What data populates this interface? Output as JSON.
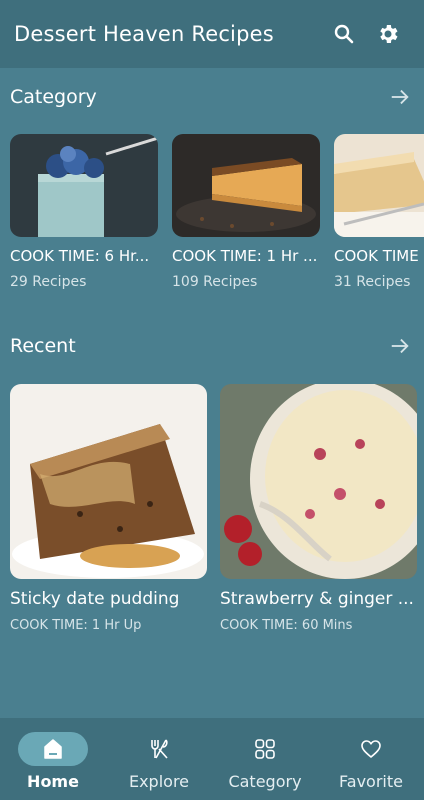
{
  "appbar": {
    "title": "Dessert Heaven Recipes",
    "search_icon": "search-icon",
    "settings_icon": "gear-icon"
  },
  "category": {
    "title": "Category",
    "items": [
      {
        "name": "COOK TIME: 6 Hr...",
        "count": "29 Recipes"
      },
      {
        "name": "COOK TIME: 1 Hr ...",
        "count": "109 Recipes"
      },
      {
        "name": "COOK TIME",
        "count": "31 Recipes"
      }
    ]
  },
  "recent": {
    "title": "Recent",
    "items": [
      {
        "name": "Sticky date pudding",
        "time": "COOK TIME: 1 Hr Up"
      },
      {
        "name": "Strawberry & ginger ...",
        "time": "COOK TIME: 60 Mins"
      }
    ]
  },
  "nav": {
    "items": [
      {
        "label": "Home",
        "active": true
      },
      {
        "label": "Explore",
        "active": false
      },
      {
        "label": "Category",
        "active": false
      },
      {
        "label": "Favorite",
        "active": false
      }
    ]
  },
  "colors": {
    "background": "#4a7f8f",
    "bars": "#3f6f7d",
    "active_pill": "#6aa8b6"
  }
}
